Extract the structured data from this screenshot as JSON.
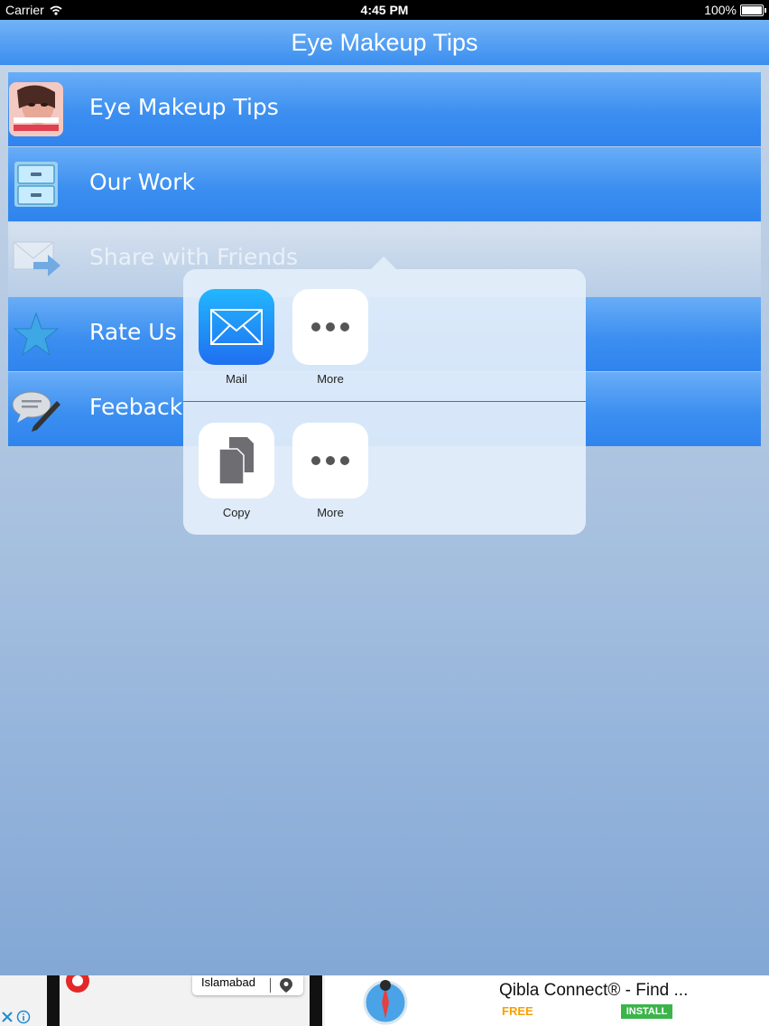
{
  "status_bar": {
    "carrier": "Carrier",
    "time": "4:45 PM",
    "battery": "100%"
  },
  "nav": {
    "title": "Eye Makeup Tips"
  },
  "menu": [
    {
      "label": "Eye Makeup Tips",
      "icon": "makeup-photo-icon"
    },
    {
      "label": "Our Work",
      "icon": "cabinet-drawer-icon"
    },
    {
      "label": "Share with Friends",
      "icon": "mail-share-icon"
    },
    {
      "label": "Rate Us",
      "icon": "star-icon"
    },
    {
      "label": "Feeback",
      "icon": "chat-pencil-icon"
    }
  ],
  "share_sheet": {
    "row1": [
      {
        "label": "Mail",
        "icon": "mail-icon"
      },
      {
        "label": "More",
        "icon": "more-icon"
      }
    ],
    "row2": [
      {
        "label": "Copy",
        "icon": "copy-icon"
      },
      {
        "label": "More",
        "icon": "more-icon"
      }
    ]
  },
  "ad": {
    "location_label": "Islamabad",
    "title": "Qibla Connect® - Find ...",
    "price": "FREE",
    "install_label": "INSTALL"
  },
  "colors": {
    "nav_top": "#72b3f5",
    "nav_bottom": "#3a8ef0",
    "ad_free": "#f5a000",
    "ad_install": "#3bb54a"
  }
}
